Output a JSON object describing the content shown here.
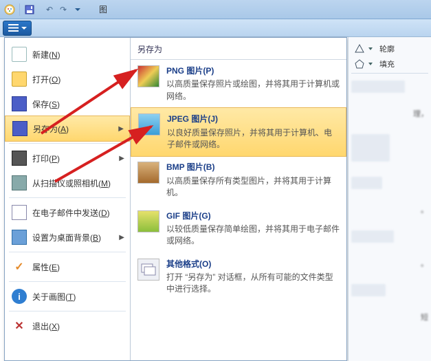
{
  "titlebar": {
    "title": "图"
  },
  "left": {
    "items": [
      {
        "label_pre": "新建(",
        "hot": "N",
        "label_post": ")",
        "icon": "new-icon"
      },
      {
        "label_pre": "打开(",
        "hot": "O",
        "label_post": ")",
        "icon": "open-icon"
      },
      {
        "label_pre": "保存(",
        "hot": "S",
        "label_post": ")",
        "icon": "save-icon"
      },
      {
        "label_pre": "另存为(",
        "hot": "A",
        "label_post": ")",
        "icon": "saveas-icon",
        "selected": true,
        "arrow": "▶"
      },
      {
        "label_pre": "打印(",
        "hot": "P",
        "label_post": ")",
        "icon": "print-icon",
        "arrow": "▶"
      },
      {
        "label_pre": "从扫描仪或照相机(",
        "hot": "M",
        "label_post": ")",
        "icon": "scanner-icon"
      },
      {
        "label_pre": "在电子邮件中发送(",
        "hot": "D",
        "label_post": ")",
        "icon": "email-icon"
      },
      {
        "label_pre": "设置为桌面背景(",
        "hot": "B",
        "label_post": ")",
        "icon": "desktop-icon",
        "arrow": "▶"
      },
      {
        "label_pre": "属性(",
        "hot": "E",
        "label_post": ")",
        "icon": "properties-icon"
      },
      {
        "label_pre": "关于画图(",
        "hot": "T",
        "label_post": ")",
        "icon": "about-icon"
      },
      {
        "label_pre": "退出(",
        "hot": "X",
        "label_post": ")",
        "icon": "exit-icon"
      }
    ]
  },
  "right": {
    "header": "另存为",
    "items": [
      {
        "title": "PNG 图片(P)",
        "desc": "以高质量保存照片或绘图，并将其用于计算机或网络。",
        "icon": "png-icon"
      },
      {
        "title": "JPEG 图片(J)",
        "desc": "以良好质量保存照片，并将其用于计算机、电子邮件或网络。",
        "icon": "jpeg-icon",
        "selected": true
      },
      {
        "title": "BMP 图片(B)",
        "desc": "以高质量保存所有类型图片，并将其用于计算机。",
        "icon": "bmp-icon"
      },
      {
        "title": "GIF 图片(G)",
        "desc": "以较低质量保存简单绘图，并将其用于电子邮件或网络。",
        "icon": "gif-icon"
      },
      {
        "title": "其他格式(O)",
        "desc": "打开 “另存为” 对话框，从所有可能的文件类型中进行选择。",
        "icon": "other-format-icon"
      }
    ]
  },
  "side": {
    "outline": "轮廓",
    "fill": "填充",
    "cropmark1": "理，",
    "cropmark2": "。",
    "cropmark3": "。",
    "cropmark4": "短"
  }
}
